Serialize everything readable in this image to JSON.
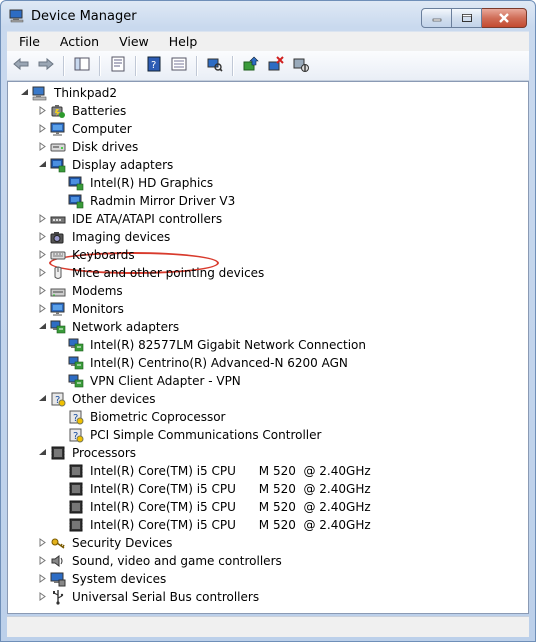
{
  "window": {
    "title": "Device Manager"
  },
  "menu": [
    "File",
    "Action",
    "View",
    "Help"
  ],
  "toolbar": {
    "buttons": [
      "back-arrow-icon",
      "forward-arrow-icon",
      "sep",
      "tree-view-icon",
      "sep",
      "properties-icon",
      "sep",
      "help-book-icon",
      "details-icon",
      "sep",
      "scan-hardware-icon",
      "sep",
      "update-driver-icon",
      "uninstall-icon",
      "disable-device-icon"
    ]
  },
  "tree": [
    {
      "label": "Thinkpad2",
      "level": 0,
      "icon": "computer-icon",
      "expanded": true
    },
    {
      "label": "Batteries",
      "level": 1,
      "icon": "battery-icon",
      "expanded": false
    },
    {
      "label": "Computer",
      "level": 1,
      "icon": "monitor-icon",
      "expanded": false
    },
    {
      "label": "Disk drives",
      "level": 1,
      "icon": "disk-icon",
      "expanded": false
    },
    {
      "label": "Display adapters",
      "level": 1,
      "icon": "display-adapter-icon",
      "expanded": true
    },
    {
      "label": "Intel(R) HD Graphics",
      "level": 2,
      "icon": "display-adapter-icon",
      "highlighted": true
    },
    {
      "label": "Radmin Mirror Driver V3",
      "level": 2,
      "icon": "display-adapter-icon"
    },
    {
      "label": "IDE ATA/ATAPI controllers",
      "level": 1,
      "icon": "ide-controller-icon",
      "expanded": false
    },
    {
      "label": "Imaging devices",
      "level": 1,
      "icon": "camera-icon",
      "expanded": false
    },
    {
      "label": "Keyboards",
      "level": 1,
      "icon": "keyboard-icon",
      "expanded": false
    },
    {
      "label": "Mice and other pointing devices",
      "level": 1,
      "icon": "mouse-icon",
      "expanded": false
    },
    {
      "label": "Modems",
      "level": 1,
      "icon": "modem-icon",
      "expanded": false
    },
    {
      "label": "Monitors",
      "level": 1,
      "icon": "monitor-icon",
      "expanded": false
    },
    {
      "label": "Network adapters",
      "level": 1,
      "icon": "network-icon",
      "expanded": true
    },
    {
      "label": "Intel(R) 82577LM Gigabit Network Connection",
      "level": 2,
      "icon": "network-icon"
    },
    {
      "label": "Intel(R) Centrino(R) Advanced-N 6200 AGN",
      "level": 2,
      "icon": "network-icon"
    },
    {
      "label": "VPN Client Adapter - VPN",
      "level": 2,
      "icon": "network-icon"
    },
    {
      "label": "Other devices",
      "level": 1,
      "icon": "unknown-device-icon",
      "expanded": true
    },
    {
      "label": "Biometric Coprocessor",
      "level": 2,
      "icon": "unknown-device-icon"
    },
    {
      "label": "PCI Simple Communications Controller",
      "level": 2,
      "icon": "unknown-device-icon"
    },
    {
      "label": "Processors",
      "level": 1,
      "icon": "processor-icon",
      "expanded": true
    },
    {
      "label": "Intel(R) Core(TM) i5 CPU      M 520  @ 2.40GHz",
      "level": 2,
      "icon": "processor-icon"
    },
    {
      "label": "Intel(R) Core(TM) i5 CPU      M 520  @ 2.40GHz",
      "level": 2,
      "icon": "processor-icon"
    },
    {
      "label": "Intel(R) Core(TM) i5 CPU      M 520  @ 2.40GHz",
      "level": 2,
      "icon": "processor-icon"
    },
    {
      "label": "Intel(R) Core(TM) i5 CPU      M 520  @ 2.40GHz",
      "level": 2,
      "icon": "processor-icon"
    },
    {
      "label": "Security Devices",
      "level": 1,
      "icon": "security-key-icon",
      "expanded": false
    },
    {
      "label": "Sound, video and game controllers",
      "level": 1,
      "icon": "speaker-icon",
      "expanded": false
    },
    {
      "label": "System devices",
      "level": 1,
      "icon": "system-device-icon",
      "expanded": false
    },
    {
      "label": "Universal Serial Bus controllers",
      "level": 1,
      "icon": "usb-icon",
      "expanded": false
    }
  ],
  "colors": {
    "highlight_oval": "#d83a2c",
    "titlebar": "#c9d9ee"
  }
}
